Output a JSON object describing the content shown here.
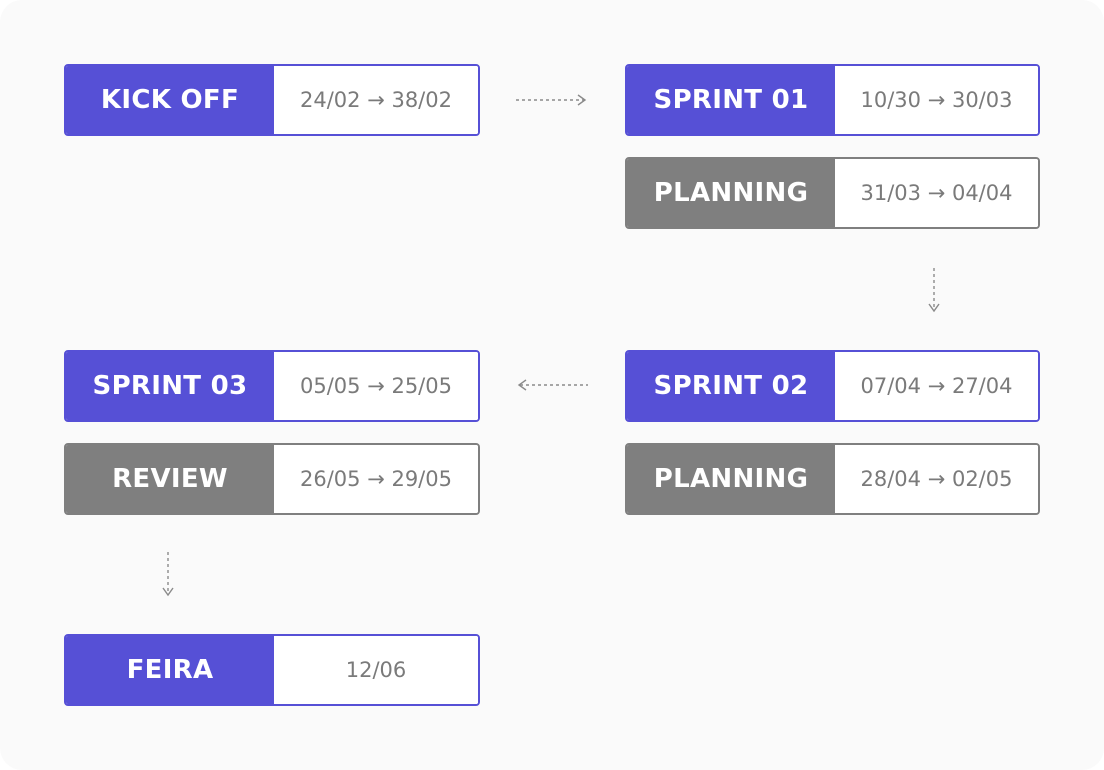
{
  "phases": [
    {
      "label": "KICK OFF",
      "dates": "24/02 → 38/02"
    },
    {
      "label": "SPRINT 01",
      "dates": "10/30 → 30/03"
    },
    {
      "label": "PLANNING",
      "dates": "31/03 → 04/04"
    },
    {
      "label": "SPRINT 02",
      "dates": "07/04 → 27/04"
    },
    {
      "label": "PLANNING",
      "dates": "28/04 → 02/05"
    },
    {
      "label": "SPRINT 03",
      "dates": "05/05 → 25/05"
    },
    {
      "label": "REVIEW",
      "dates": "26/05 → 29/05"
    },
    {
      "label": "FEIRA",
      "dates": "12/06"
    }
  ],
  "colors": {
    "sprint": "#5650d6",
    "phase_gray": "#7f7f7f",
    "date_text": "#7a7a7a",
    "arrow": "#8a8a8a",
    "background": "#fafafa"
  },
  "icons": [
    "arrow-right-icon",
    "arrow-down-icon",
    "arrow-left-icon"
  ]
}
